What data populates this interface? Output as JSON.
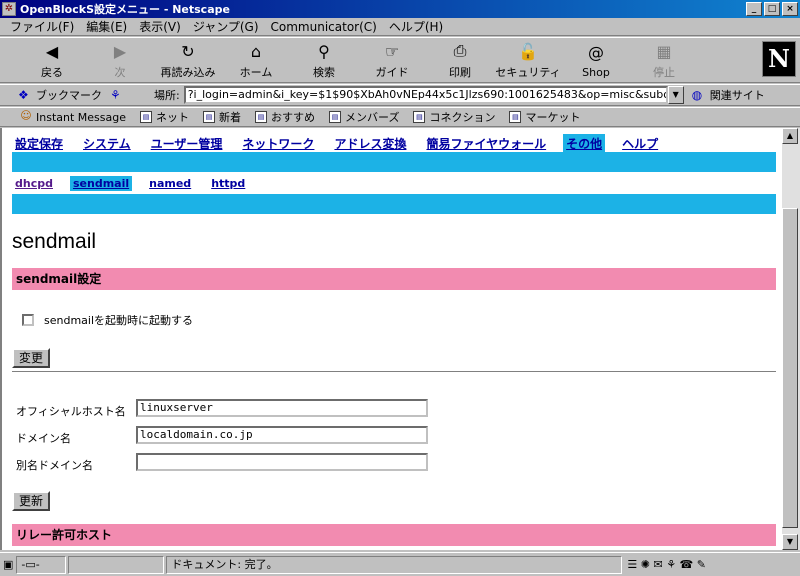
{
  "window": {
    "title": "OpenBlockS設定メニュー - Netscape",
    "min": "_",
    "max": "□",
    "close": "×"
  },
  "menubar": [
    "ファイル(F)",
    "編集(E)",
    "表示(V)",
    "ジャンプ(G)",
    "Communicator(C)",
    "ヘルプ(H)"
  ],
  "toolbar": [
    {
      "label": "戻る",
      "icon": "back-icon",
      "glyph": "◀",
      "disabled": false
    },
    {
      "label": "次",
      "icon": "forward-icon",
      "glyph": "▶",
      "disabled": true
    },
    {
      "label": "再読み込み",
      "icon": "reload-icon",
      "glyph": "↻",
      "disabled": false
    },
    {
      "label": "ホーム",
      "icon": "home-icon",
      "glyph": "⌂",
      "disabled": false
    },
    {
      "label": "検索",
      "icon": "search-icon",
      "glyph": "⚲",
      "disabled": false
    },
    {
      "label": "ガイド",
      "icon": "guide-icon",
      "glyph": "☞",
      "disabled": false
    },
    {
      "label": "印刷",
      "icon": "print-icon",
      "glyph": "⎙",
      "disabled": false
    },
    {
      "label": "セキュリティ",
      "icon": "lock-icon",
      "glyph": "🔓",
      "disabled": false
    },
    {
      "label": "Shop",
      "icon": "shop-icon",
      "glyph": "@",
      "disabled": false
    },
    {
      "label": "停止",
      "icon": "stop-icon",
      "glyph": "▦",
      "disabled": true
    }
  ],
  "logo": "N",
  "location": {
    "bookmarks_label": "ブックマーク",
    "label": "場所:",
    "url": "?i_login=admin&i_key=$1$90$XbAh0vNEp44x5c1Jlzs690:1001625483&op=misc&subop=sendmail",
    "related": "関連サイト"
  },
  "personal": [
    {
      "label": "Instant Message",
      "icon": "person-icon"
    },
    {
      "label": "ネット",
      "icon": "bookmark-icon"
    },
    {
      "label": "新着",
      "icon": "bookmark-icon"
    },
    {
      "label": "おすすめ",
      "icon": "bookmark-icon"
    },
    {
      "label": "メンバーズ",
      "icon": "bookmark-icon"
    },
    {
      "label": "コネクション",
      "icon": "bookmark-icon"
    },
    {
      "label": "マーケット",
      "icon": "bookmark-icon"
    }
  ],
  "colors": {
    "accent": "#1cb2e6",
    "section": "#f28bb0"
  },
  "nav_tabs": [
    {
      "label": "設定保存",
      "active": false
    },
    {
      "label": "システム",
      "active": false
    },
    {
      "label": "ユーザー管理",
      "active": false
    },
    {
      "label": "ネットワーク",
      "active": false
    },
    {
      "label": "アドレス変換",
      "active": false
    },
    {
      "label": "簡易ファイヤウォール",
      "active": false
    },
    {
      "label": "その他",
      "active": true
    },
    {
      "label": "ヘルプ",
      "active": false
    }
  ],
  "sub_tabs": [
    {
      "label": "dhcpd",
      "active": false,
      "visited": true
    },
    {
      "label": "sendmail",
      "active": true,
      "visited": false
    },
    {
      "label": "named",
      "active": false,
      "visited": false
    },
    {
      "label": "httpd",
      "active": false,
      "visited": false
    }
  ],
  "page": {
    "title": "sendmail",
    "section1": "sendmail設定",
    "startup_checkbox_label": "sendmailを起動時に起動する",
    "startup_checked": false,
    "change_button": "変更",
    "fields": [
      {
        "label": "オフィシャルホスト名",
        "value": "linuxserver"
      },
      {
        "label": "ドメイン名",
        "value": "localdomain.co.jp"
      },
      {
        "label": "別名ドメイン名",
        "value": ""
      }
    ],
    "update_button": "更新",
    "section2": "リレー許可ホスト"
  },
  "status": {
    "text": "ドキュメント: 完了。"
  }
}
